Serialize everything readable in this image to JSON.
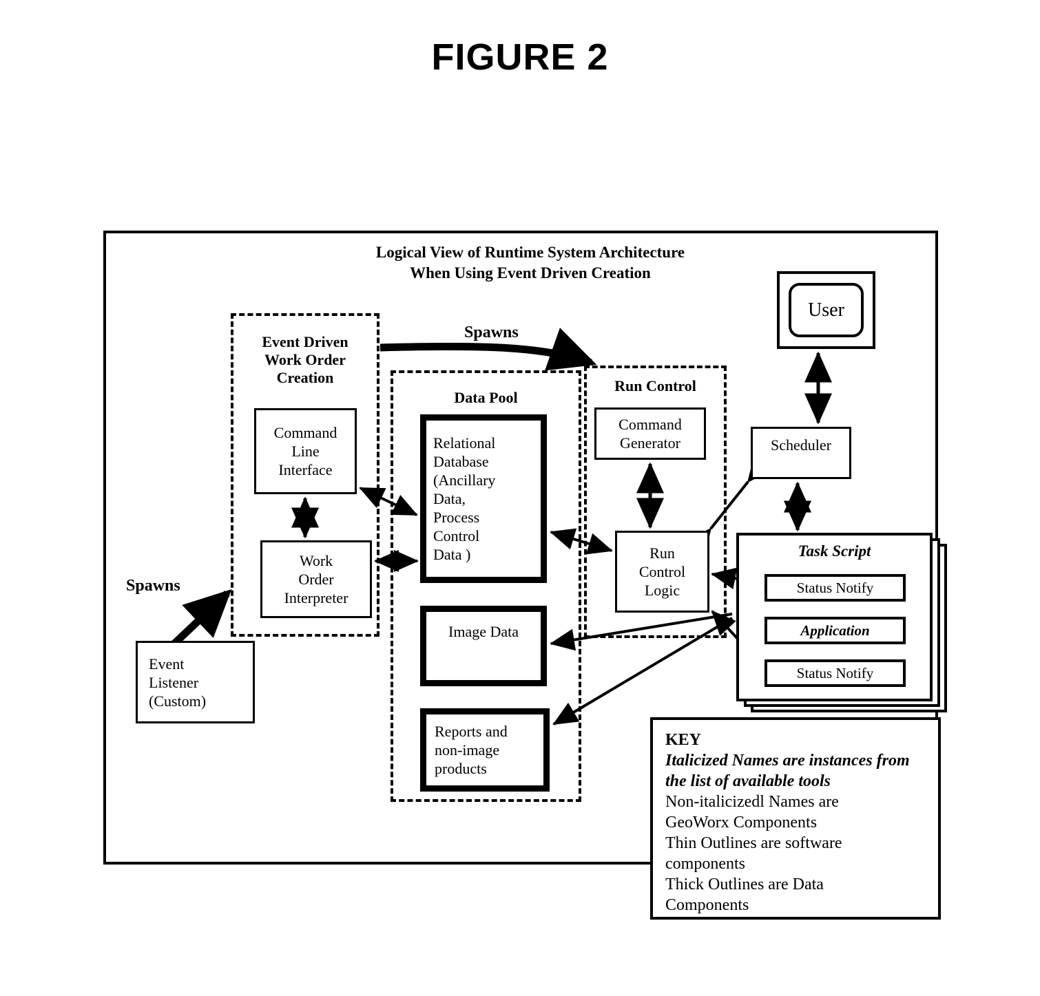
{
  "figure": {
    "title": "FIGURE 2"
  },
  "diagram": {
    "heading_line1": "Logical View of Runtime System Architecture",
    "heading_line2": "When Using Event Driven Creation"
  },
  "groups": {
    "event_driven_work_order_creation": {
      "label": "Event Driven\nWork Order\nCreation",
      "label_lines": [
        "Event Driven",
        "Work Order",
        "Creation"
      ],
      "boxes": [
        {
          "name": "command-line-interface",
          "label_lines": [
            "Command",
            "Line",
            "Interface"
          ],
          "outline": "thin",
          "style": "normal"
        },
        {
          "name": "work-order-interpreter",
          "label_lines": [
            "Work",
            "Order",
            "Interpreter"
          ],
          "outline": "thin",
          "style": "normal"
        }
      ]
    },
    "data_pool": {
      "label": "Data Pool",
      "boxes": [
        {
          "name": "relational-database",
          "label_lines": [
            "Relational",
            "Database",
            "(Ancillary",
            "Data,",
            "Process",
            "Control",
            "Data )"
          ],
          "outline": "thick",
          "style": "normal"
        },
        {
          "name": "image-data",
          "label_lines": [
            "Image Data"
          ],
          "outline": "thick",
          "style": "normal"
        },
        {
          "name": "reports-and-non-image-products",
          "label_lines": [
            "Reports and",
            "non-image",
            "products"
          ],
          "outline": "thick",
          "style": "normal"
        }
      ]
    },
    "run_control": {
      "label": "Run Control",
      "boxes": [
        {
          "name": "command-generator",
          "label_lines": [
            "Command",
            "Generator"
          ],
          "outline": "thin",
          "style": "normal"
        },
        {
          "name": "run-control-logic",
          "label_lines": [
            "Run",
            "Control",
            "Logic"
          ],
          "outline": "thin",
          "style": "normal"
        }
      ]
    }
  },
  "standalone_boxes": {
    "event_listener": {
      "label_lines": [
        "Event",
        "Listener",
        "(Custom)"
      ],
      "outline": "thin"
    },
    "user": {
      "label": "User",
      "outline": "thin",
      "shape": "rounded-in-square"
    },
    "scheduler": {
      "label": "Scheduler",
      "outline": "thin"
    }
  },
  "task_script": {
    "title": "Task Script",
    "title_style": "italic",
    "stack_count": 3,
    "slots": [
      {
        "label": "Status Notify",
        "style": "normal"
      },
      {
        "label": "Application",
        "style": "italic"
      },
      {
        "label": "Status Notify",
        "style": "normal"
      }
    ]
  },
  "edge_labels": {
    "spawns_top": "Spawns",
    "spawns_left": "Spawns"
  },
  "key": {
    "heading": "KEY",
    "lines": [
      {
        "text": "Italicized Names are instances from",
        "style": "italic"
      },
      {
        "text": "the list of available tools",
        "style": "italic"
      },
      {
        "text": "Non-italicizedl Names are",
        "style": "normal"
      },
      {
        "text": "GeoWorx Components",
        "style": "normal"
      },
      {
        "text": "Thin Outlines are software",
        "style": "normal"
      },
      {
        "text": "components",
        "style": "normal"
      },
      {
        "text": "Thick Outlines are Data",
        "style": "normal"
      },
      {
        "text": "Components",
        "style": "normal"
      }
    ]
  },
  "colors": {
    "ink": "#000000",
    "paper": "#ffffff"
  }
}
